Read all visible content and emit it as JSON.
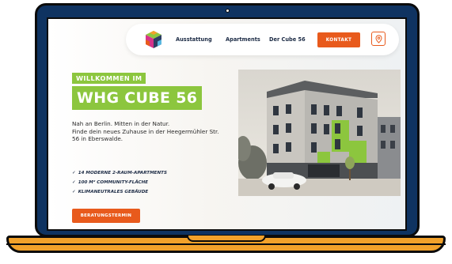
{
  "nav": {
    "links": [
      "Ausstattung",
      "Apartments",
      "Der Cube 56"
    ],
    "cta": "KONTAKT"
  },
  "hero": {
    "kicker": "WILLKOMMEN IM",
    "title": "WHG CUBE 56",
    "intro_line1": "Nah an Berlin. Mitten in der Natur.",
    "intro_line2": "Finde dein neues Zuhause in der Heegermühler Str. 56 in Eberswalde.",
    "features": [
      "14 MODERNE 2-RAUM-APARTMENTS",
      "100 M² COMMUNITY-FLÄCHE",
      "KLIMANEUTRALES GEBÄUDE"
    ],
    "cta": "BERATUNGSTERMIN"
  },
  "icons": {
    "logo": "cube-logo-icon",
    "location": "location-pin-icon",
    "check": "check-icon"
  },
  "colors": {
    "accent_green": "#8cc63e",
    "accent_orange": "#e85a1c",
    "laptop_blue": "#0f3361",
    "laptop_base": "#f2a12a"
  }
}
